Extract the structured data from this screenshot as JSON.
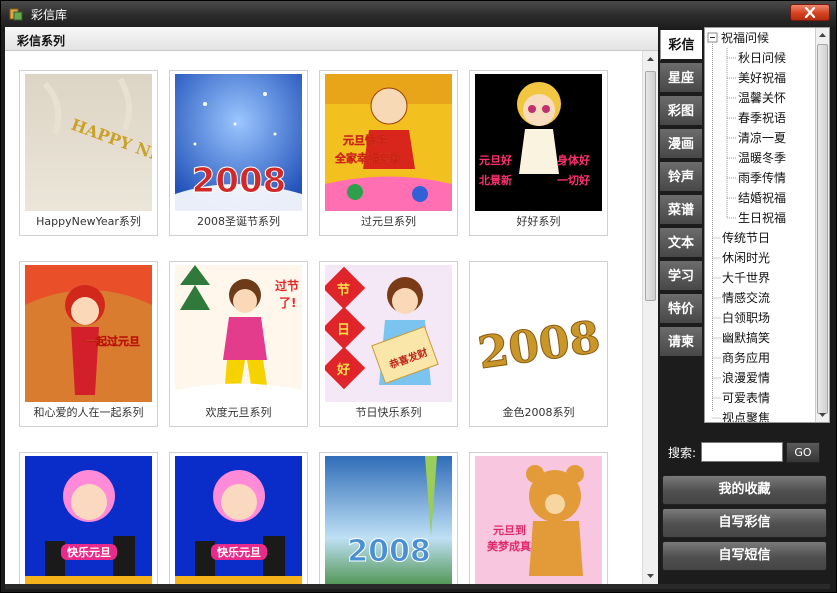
{
  "window": {
    "title": "彩信库",
    "colors": {
      "frame": "#1c1c1c",
      "close_button": "#d4421f"
    }
  },
  "content": {
    "section_title": "彩信系列",
    "tiles": [
      {
        "label": "HappyNewYear系列",
        "thumb_text": "HAPPY NEW YEAR"
      },
      {
        "label": "2008圣诞节系列",
        "thumb_text": "2008"
      },
      {
        "label": "过元旦系列",
        "thumb_text": "元旦快乐 全家幸福安康"
      },
      {
        "label": "好好系列",
        "thumb_text": "元旦好 北景新 身体好 一切好"
      },
      {
        "label": "和心爱的人在一起系列",
        "thumb_text": "一起过元旦"
      },
      {
        "label": "欢度元旦系列",
        "thumb_text": "过节了!"
      },
      {
        "label": "节日快乐系列",
        "thumb_text": "节日好 恭喜发财"
      },
      {
        "label": "金色2008系列",
        "thumb_text": "2008"
      },
      {
        "label": "",
        "thumb_text": "快乐元旦"
      },
      {
        "label": "",
        "thumb_text": "快乐元旦"
      },
      {
        "label": "",
        "thumb_text": "2008"
      },
      {
        "label": "",
        "thumb_text": "元旦到 美梦成真"
      }
    ]
  },
  "tabs": [
    {
      "label": "彩信",
      "active": true
    },
    {
      "label": "星座",
      "active": false
    },
    {
      "label": "彩图",
      "active": false
    },
    {
      "label": "漫画",
      "active": false
    },
    {
      "label": "铃声",
      "active": false
    },
    {
      "label": "菜谱",
      "active": false
    },
    {
      "label": "文本",
      "active": false
    },
    {
      "label": "学习",
      "active": false
    },
    {
      "label": "特价",
      "active": false
    },
    {
      "label": "请柬",
      "active": false
    }
  ],
  "tree": {
    "root": {
      "label": "祝福问候",
      "expander": "⊟"
    },
    "children": [
      "秋日问候",
      "美好祝福",
      "温馨关怀",
      "春季祝语",
      "清凉一夏",
      "温暖冬季",
      "雨季传情",
      "结婚祝福",
      "生日祝福"
    ],
    "top_level": [
      "传统节日",
      "休闲时光",
      "大千世界",
      "情感交流",
      "白领职场",
      "幽默搞笑",
      "商务应用",
      "浪漫爱情",
      "可爱表情",
      "视点聚焦"
    ]
  },
  "search": {
    "label": "搜索:",
    "value": "",
    "go_label": "GO"
  },
  "side_buttons": {
    "favorites": "我的收藏",
    "write_mms": "自写彩信",
    "write_sms": "自写短信"
  }
}
